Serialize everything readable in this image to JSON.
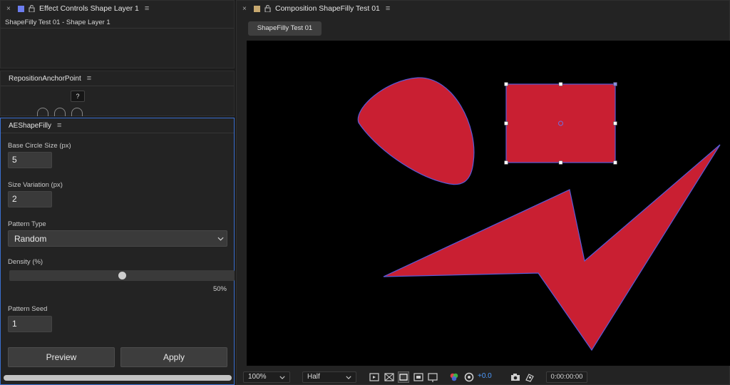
{
  "effect_controls": {
    "title": "Effect Controls Shape Layer 1",
    "layer_path": "ShapeFilly Test 01 - Shape Layer 1",
    "swatch_color": "#6c7df0"
  },
  "reposition_panel": {
    "title": "RepositionAnchorPoint",
    "help_label": "?"
  },
  "shapefilly_panel": {
    "title": "AEShapeFilly",
    "base_circle_label": "Base Circle Size (px)",
    "base_circle_value": "5",
    "size_variation_label": "Size Variation (px)",
    "size_variation_value": "2",
    "pattern_type_label": "Pattern Type",
    "pattern_type_value": "Random",
    "density_label": "Density (%)",
    "density_value": 0.5,
    "density_text": "50%",
    "pattern_seed_label": "Pattern Seed",
    "pattern_seed_value": "1",
    "preview_label": "Preview",
    "apply_label": "Apply"
  },
  "composition": {
    "title": "Composition ShapeFilly Test 01",
    "swatch_color": "#c7a86f",
    "comp_tab": "ShapeFilly Test 01",
    "shape_fill": "#c91f32",
    "shape_stroke": "#5a5ad8"
  },
  "viewer_toolbar": {
    "zoom": "100%",
    "resolution": "Half",
    "exposure": "+0.0",
    "timecode": "0:00:00:00"
  }
}
